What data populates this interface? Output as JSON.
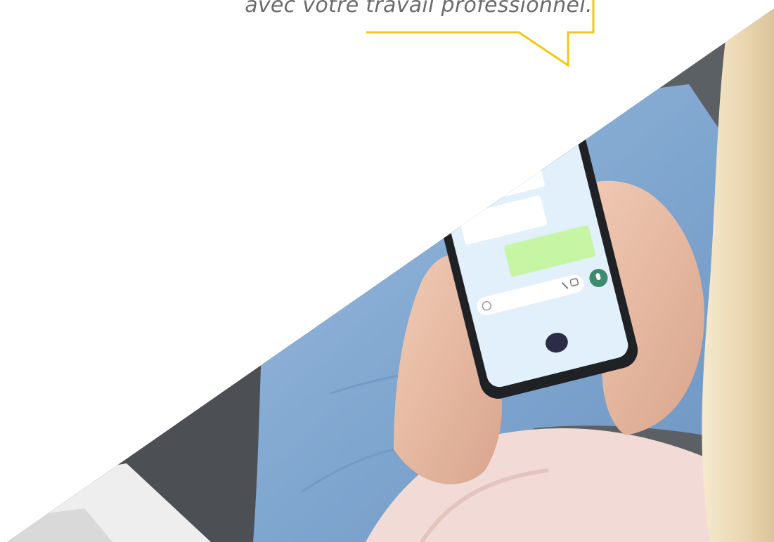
{
  "quote": {
    "text": "avec votre travail professionnel."
  },
  "colors": {
    "accent_yellow": "#f3c910",
    "quote_text": "#6b6b6b",
    "chat_background": "#e1f0fb",
    "outgoing_bubble": "#c6f5a4",
    "send_button": "#3e8a6e",
    "denim": "#7fa6cf",
    "sofa": "#5b6064",
    "sweater": "#f2dad6",
    "skin": "#e7b9a2",
    "hair": "#ecd9b4"
  },
  "icons": {
    "send": "microphone-icon",
    "attach": "paperclip-icon",
    "camera": "camera-icon",
    "emoji": "emoji-icon"
  }
}
